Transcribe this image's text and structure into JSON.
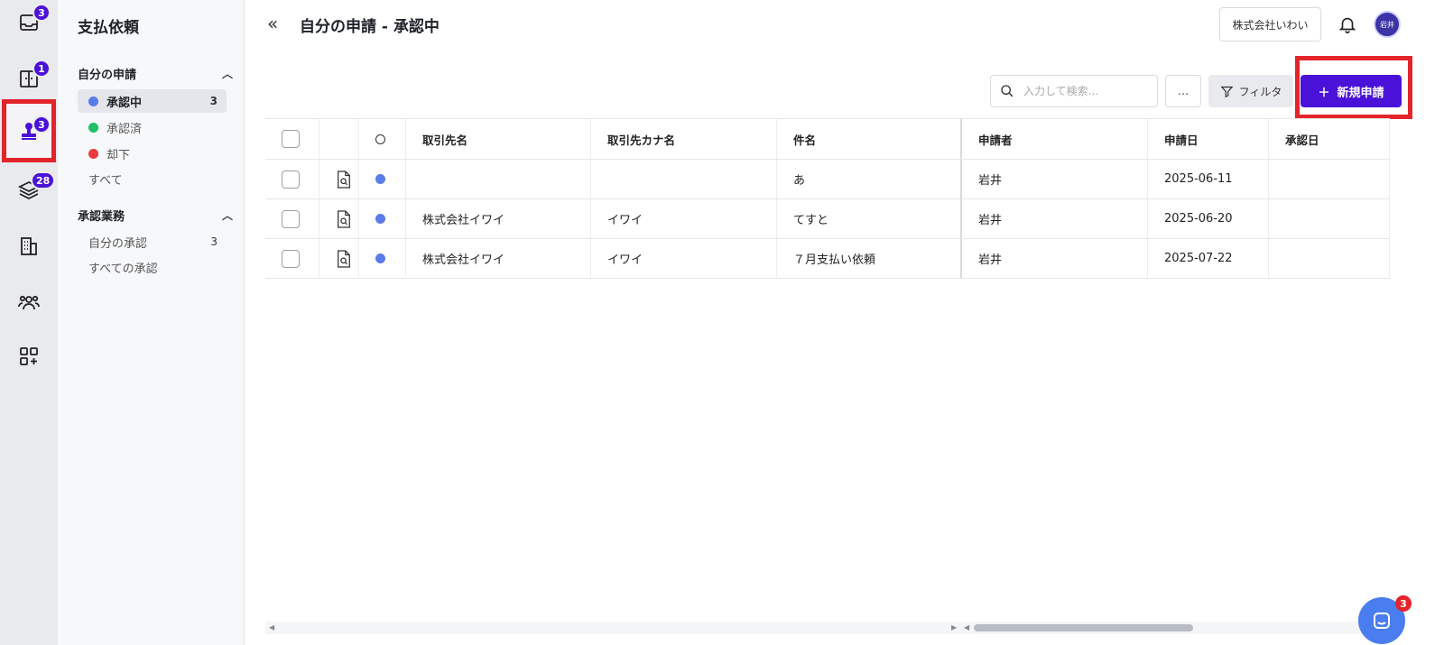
{
  "rail": {
    "inbox_badge": "3",
    "book_badge": "1",
    "stamp_badge": "3",
    "layers_badge": "28"
  },
  "subnav": {
    "title": "支払依頼",
    "section_my_requests": "自分の申請",
    "items": [
      {
        "label": "承認中",
        "count": "3",
        "dot_color": "#5b7be8"
      },
      {
        "label": "承認済",
        "count": "",
        "dot_color": "#1fbe6a"
      },
      {
        "label": "却下",
        "count": "",
        "dot_color": "#ec3a3f"
      }
    ],
    "all_label": "すべて",
    "section_approval": "承認業務",
    "approval_items": [
      {
        "label": "自分の承認",
        "count": "3"
      },
      {
        "label": "すべての承認",
        "count": ""
      }
    ]
  },
  "header": {
    "title": "自分の申請 - 承認中",
    "company": "株式会社いわい",
    "avatar": "岩井"
  },
  "toolbar": {
    "search_placeholder": "入力して検索...",
    "more_label": "...",
    "filter_label": "フィルタ",
    "new_label": "新規申請"
  },
  "table": {
    "columns": [
      "取引先名",
      "取引先カナ名",
      "件名",
      "申請者",
      "申請日",
      "承認日"
    ],
    "rows": [
      {
        "vendor": "",
        "kana": "",
        "subject": "あ",
        "applicant": "岩井",
        "date": "2025-06-11",
        "approved": ""
      },
      {
        "vendor": "株式会社イワイ",
        "kana": "イワイ",
        "subject": "てすと",
        "applicant": "岩井",
        "date": "2025-06-20",
        "approved": ""
      },
      {
        "vendor": "株式会社イワイ",
        "kana": "イワイ",
        "subject": "７月支払い依頼",
        "applicant": "岩井",
        "date": "2025-07-22",
        "approved": ""
      }
    ]
  },
  "chat": {
    "badge": "3"
  },
  "colors": {
    "accent": "#4a12d8",
    "highlight": "#e3242b",
    "status_pending": "#5b7be8"
  }
}
